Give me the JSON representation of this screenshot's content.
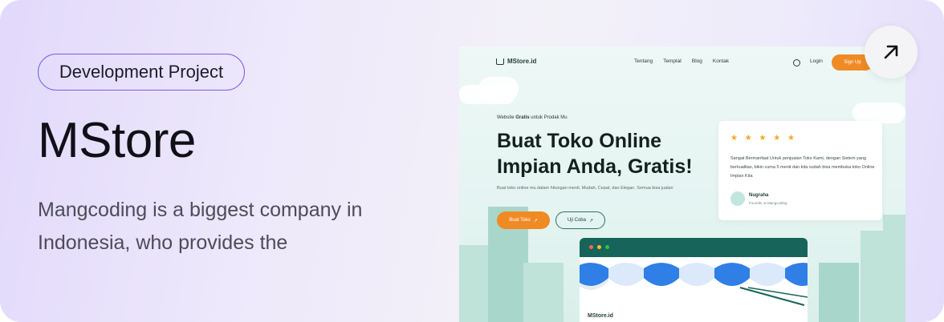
{
  "card": {
    "badge": "Development Project",
    "title": "MStore",
    "description": "Mangcoding is a biggest company in Indonesia, who provides the",
    "open_icon": "arrow-up-right-icon"
  },
  "preview": {
    "brand": "MStore.id",
    "nav": [
      "Tentang",
      "Templat",
      "Blog",
      "Kontak"
    ],
    "login": "Login",
    "signup": "Sign Up",
    "eyebrow_prefix": "Website",
    "eyebrow_bold": "Gratis",
    "eyebrow_suffix": "untuk Prodak Mu",
    "headline_line1": "Buat Toko Online",
    "headline_line2": "Impian Anda, Gratis!",
    "subtext": "Buat toko online mu dalam hitungan menit. Mudah, Cepat, dan Elegan. Semua bisa jualan",
    "cta_primary": "Buat Toko",
    "cta_secondary": "Uji Coba",
    "review": {
      "stars": "★ ★ ★ ★ ★",
      "text": "Sangat Bermanfaat Untuk penjualan Toko Kami, dengan Sistem yang berkualitas, bikin cuma 5 menit dan kita sudah bisa membuka toko Online Impian Kita",
      "name": "Nugraha",
      "role": "Founder at Mangcoding"
    },
    "store_brand": "MStore.id"
  },
  "colors": {
    "accent_purple": "#7c5ce6",
    "orange": "#f08a24",
    "teal": "#17645a",
    "awning_blue": "#2f7fe6"
  }
}
